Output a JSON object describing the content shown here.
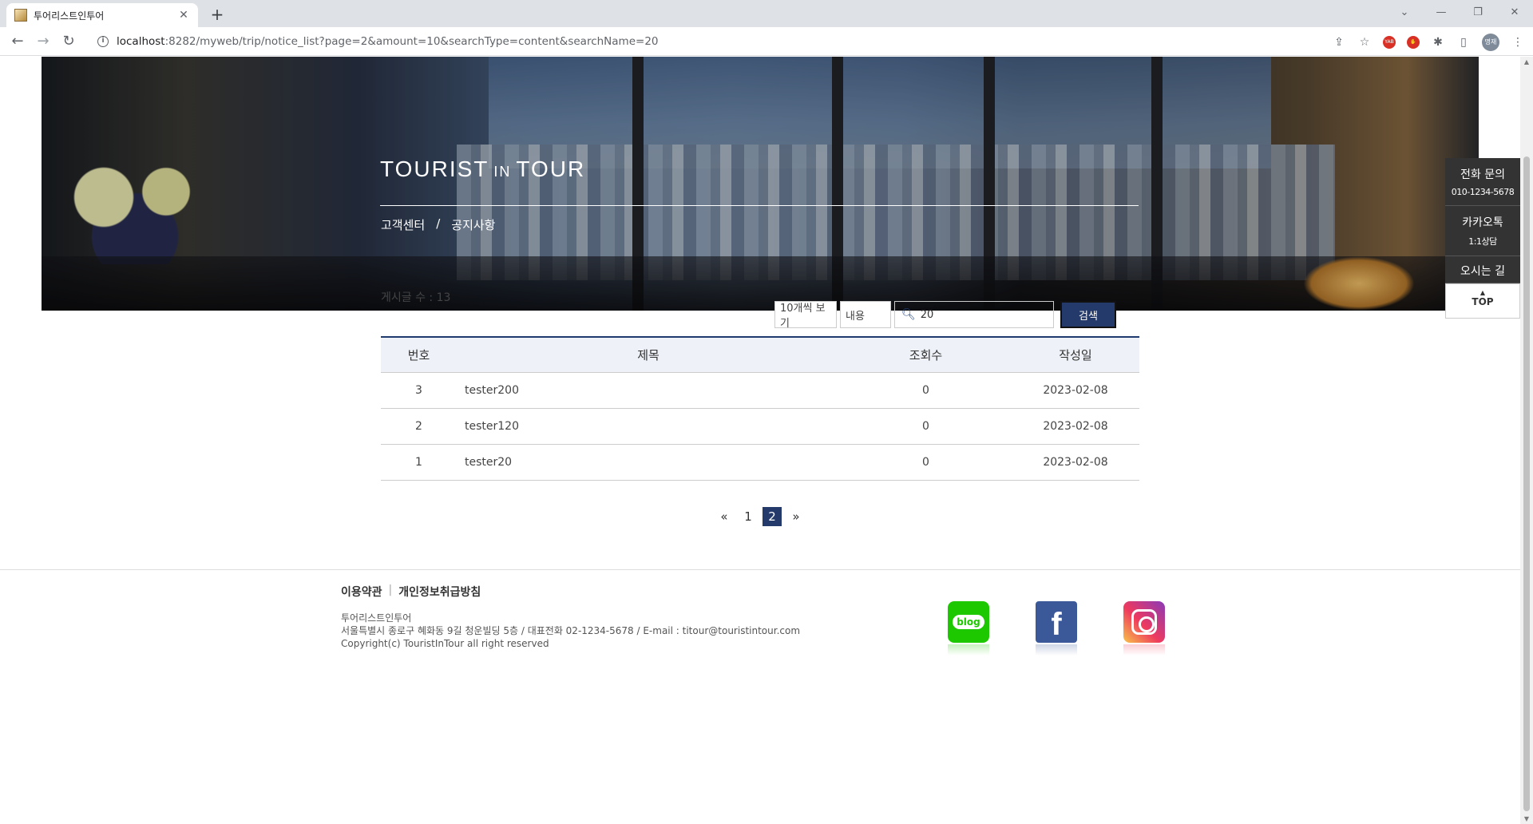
{
  "browser": {
    "tab_title": "투어리스트인투어",
    "url_host": "localhost",
    "url_rest": ":8282/myweb/trip/notice_list?page=2&amount=10&searchType=content&searchName=20",
    "profile_label": "명재"
  },
  "hero": {
    "title_left": "TOURIST",
    "title_mid": "IN",
    "title_right": "TOUR",
    "breadcrumb": [
      "고객센터",
      "/",
      "공지사항"
    ]
  },
  "quick_menu": {
    "phone_label": "전화 문의",
    "phone_number": "010-1234-5678",
    "kakao_label": "카카오톡",
    "kakao_sub": "1:1상담",
    "directions_label": "오시는 길",
    "top_label": "TOP"
  },
  "board": {
    "count_text": "게시글 수 : 13",
    "amount_select": "10개씩 보기",
    "type_select": "내용",
    "search_value": "20",
    "search_button": "검색",
    "columns": [
      "번호",
      "제목",
      "조회수",
      "작성일"
    ],
    "rows": [
      {
        "no": "3",
        "title": "tester200",
        "views": "0",
        "date": "2023-02-08"
      },
      {
        "no": "2",
        "title": "tester120",
        "views": "0",
        "date": "2023-02-08"
      },
      {
        "no": "1",
        "title": "tester20",
        "views": "0",
        "date": "2023-02-08"
      }
    ],
    "pagination": {
      "prev": "«",
      "pages": [
        "1",
        "2"
      ],
      "current": "2",
      "next": "»"
    }
  },
  "footer": {
    "terms": "이용약관",
    "separator": "|",
    "privacy": "개인정보취급방침",
    "company": "투어리스트인투어",
    "address": "서울특별시 종로구 혜화동 9길 청운빌딩 5층 / 대표전화 02-1234-5678 / E-mail : titour@touristintour.com",
    "copyright": "Copyright(c) TouristInTour all right reserved",
    "blog_label": "blog",
    "facebook_label": "f"
  },
  "colors": {
    "accent": "#233a6b",
    "table_header_bg": "#eef1f7",
    "blog_green": "#1ec800",
    "facebook_blue": "#3b5998"
  }
}
